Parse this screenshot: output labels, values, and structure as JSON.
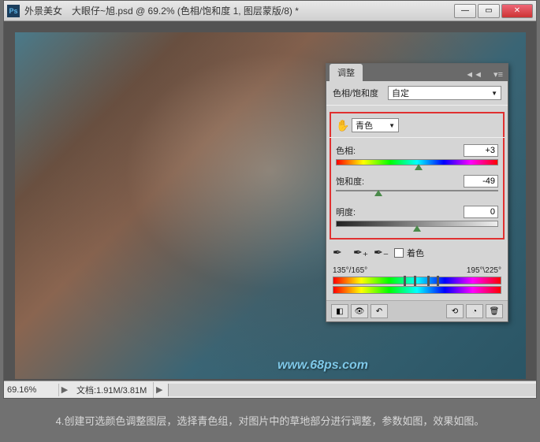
{
  "titlebar": {
    "ps": "Ps",
    "title": "外景美女　大眼仔~旭.psd @ 69.2% (色相/饱和度 1, 图层蒙版/8) *"
  },
  "statusbar": {
    "zoom": "69.16%",
    "doc": "文档:1.91M/3.81M"
  },
  "watermark": "www.68ps.com",
  "panel": {
    "tab": "调整",
    "adj_label": "色相/饱和度",
    "preset": "自定",
    "channel": "青色",
    "hue_label": "色相:",
    "hue_value": "+3",
    "sat_label": "饱和度:",
    "sat_value": "-49",
    "light_label": "明度:",
    "light_value": "0",
    "colorize": "着色",
    "range_left": "135°/165°",
    "range_right": "195°\\225°"
  },
  "caption": "4.创建可选颜色调整图层，选择青色组，对图片中的草地部分进行调整，参数如图，效果如图。"
}
